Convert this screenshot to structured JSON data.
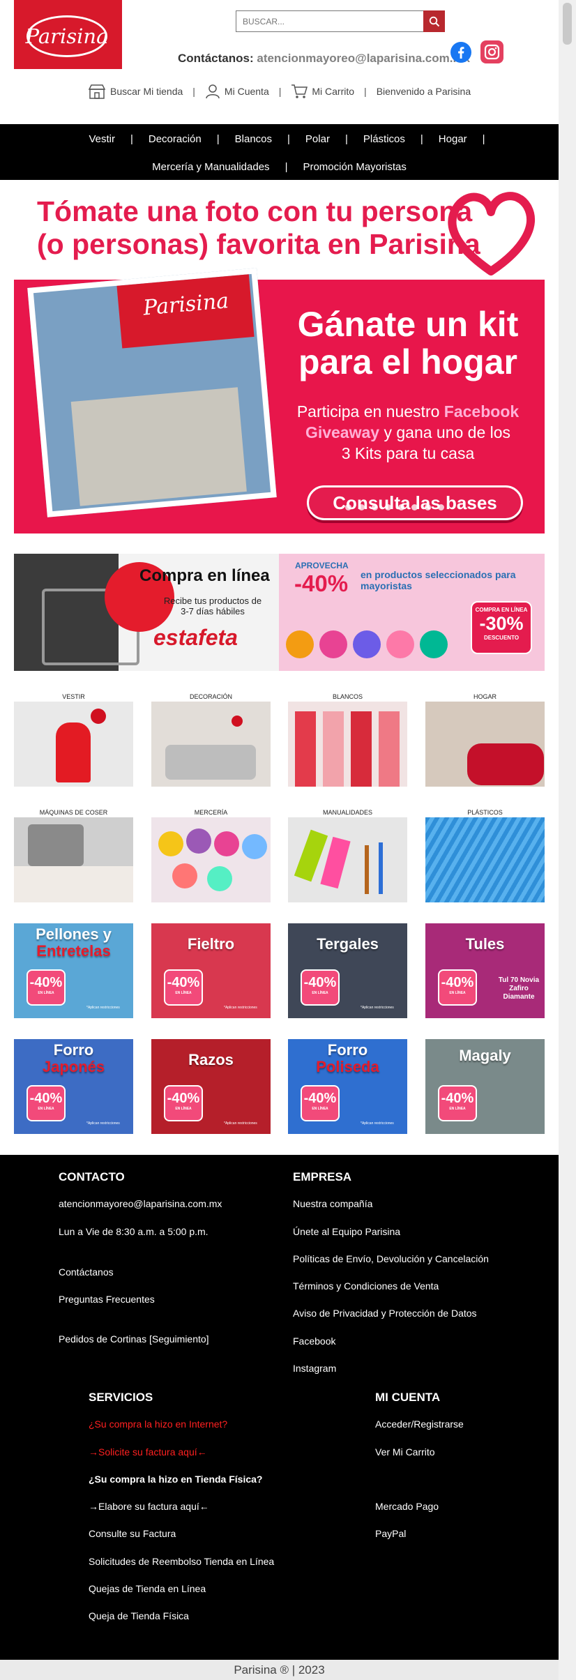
{
  "header": {
    "logo_text": "Parisina",
    "search_placeholder": "BUSCAR...",
    "contact_label": "Contáctanos:",
    "contact_email": "atencionmayoreo@laparisina.com.mx",
    "links": {
      "store": "Buscar Mi tienda",
      "account": "Mi Cuenta",
      "cart": "Mi Carrito",
      "welcome": "Bienvenido a Parisina"
    },
    "colors": {
      "brand": "#d7192b",
      "facebook": "#1877f2",
      "instagram": "#e4405f"
    }
  },
  "nav": {
    "row1": [
      "Vestir",
      "Decoración",
      "Blancos",
      "Polar",
      "Plásticos",
      "Hogar"
    ],
    "row2": [
      "Mercería y Manualidades",
      "Promoción Mayoristas"
    ]
  },
  "hero": {
    "headline_1": "Tómate una foto con tu persona",
    "headline_2": "(o personas) favorita en Parisina",
    "sub_1": "Gánate un kit",
    "sub_2": "para el hogar",
    "body_1": "Participa en nuestro",
    "body_fb": "Facebook Giveaway",
    "body_2": "y gana uno de los",
    "body_3": "3 Kits para tu casa",
    "button": "Consulta las bases",
    "store_sign": "Parisina"
  },
  "banners": {
    "left": {
      "title": "Compra en línea",
      "subtitle": "Recibe tus productos de 3-7 días hábiles",
      "carrier": "estafeta"
    },
    "right": {
      "tag": "APROVECHA",
      "discount": "-40%",
      "text": "en productos seleccionados para mayoristas",
      "badge_top": "COMPRA EN LÍNEA",
      "badge_pct": "-30%",
      "badge_bottom": "DESCUENTO"
    }
  },
  "categories": [
    {
      "label": "VESTIR",
      "color": "#e9e9e9"
    },
    {
      "label": "DECORACIÓN",
      "color": "#e2ddd8"
    },
    {
      "label": "BLANCOS",
      "color": "#f1e3e3"
    },
    {
      "label": "HOGAR",
      "color": "#d6c9bd"
    },
    {
      "label": "MÁQUINAS DE COSER",
      "color": "#cfcfcf"
    },
    {
      "label": "MERCERÍA",
      "color": "#efe4ea"
    },
    {
      "label": "MANUALIDADES",
      "color": "#e6e6e6"
    },
    {
      "label": "PLÁSTICOS",
      "color": "#3a9be0"
    }
  ],
  "promos": [
    {
      "title_1": "Pellones y",
      "title_2": "Entretelas",
      "discount": "-40%",
      "sub": "EN LÍNEA",
      "note": "*Aplican restricciones",
      "color": "#5aa7d6"
    },
    {
      "title_1": "Fieltro",
      "title_2": "",
      "discount": "-40%",
      "sub": "EN LÍNEA",
      "note": "*Aplican restricciones",
      "color": "#d8384f"
    },
    {
      "title_1": "Tergales",
      "title_2": "",
      "discount": "-40%",
      "sub": "EN LÍNEA",
      "note": "*Aplican restricciones",
      "color": "#3f4757"
    },
    {
      "title_1": "Tules",
      "title_2": "",
      "discount": "-40%",
      "sub": "EN LÍNEA",
      "note": "Tul 70 Novia Zafiro Diamante",
      "color": "#a82a78"
    },
    {
      "title_1": "Forro",
      "title_2": "Japonés",
      "discount": "-40%",
      "sub": "EN LÍNEA",
      "note": "*Aplican restricciones",
      "color": "#3d6cc4"
    },
    {
      "title_1": "Razos",
      "title_2": "",
      "discount": "-40%",
      "sub": "EN LÍNEA",
      "note": "*Aplican restricciones",
      "color": "#b51f2a"
    },
    {
      "title_1": "Forro",
      "title_2": "Poliseda",
      "discount": "-40%",
      "sub": "EN LÍNEA",
      "note": "*Aplican restricciones",
      "color": "#2f6fd0"
    },
    {
      "title_1": "Magaly",
      "title_2": "",
      "discount": "-40%",
      "sub": "EN LÍNEA",
      "note": "",
      "color": "#7a8a8a"
    }
  ],
  "footer": {
    "contacto": {
      "heading": "CONTACTO",
      "email": "atencionmayoreo@laparisina.com.mx",
      "hours": "Lun a Vie de 8:30 a.m. a 5:00 p.m.",
      "contact": "Contáctanos",
      "faq": "Preguntas Frecuentes",
      "curtains": "Pedidos de Cortinas [Seguimiento]"
    },
    "empresa": {
      "heading": "EMPRESA",
      "items": [
        "Nuestra compañía",
        "Únete al Equipo Parisina",
        "Políticas de Envío, Devolución y Cancelación",
        "Términos y Condiciones de Venta",
        "Aviso de Privacidad y Protección de Datos",
        "Facebook",
        "Instagram"
      ]
    },
    "servicios": {
      "heading": "SERVICIOS",
      "internet_q": "¿Su compra la hizo en Internet?",
      "internet_link": "→Solicite su factura aquí←",
      "store_q": "¿Su compra la hizo en Tienda Física?",
      "store_link": "→Elabore su factura aquí←",
      "consult": "Consulte su Factura",
      "refund": "Solicitudes de Reembolso Tienda en Línea",
      "complaints_online": "Quejas de Tienda en Línea",
      "complaints_store": "Queja de Tienda Física"
    },
    "cuenta": {
      "heading": "MI CUENTA",
      "login": "Acceder/Registrarse",
      "cart": "Ver Mi Carrito",
      "mercado": "Mercado Pago",
      "paypal": "PayPal"
    },
    "copyright": "Parisina ® | 2023"
  }
}
